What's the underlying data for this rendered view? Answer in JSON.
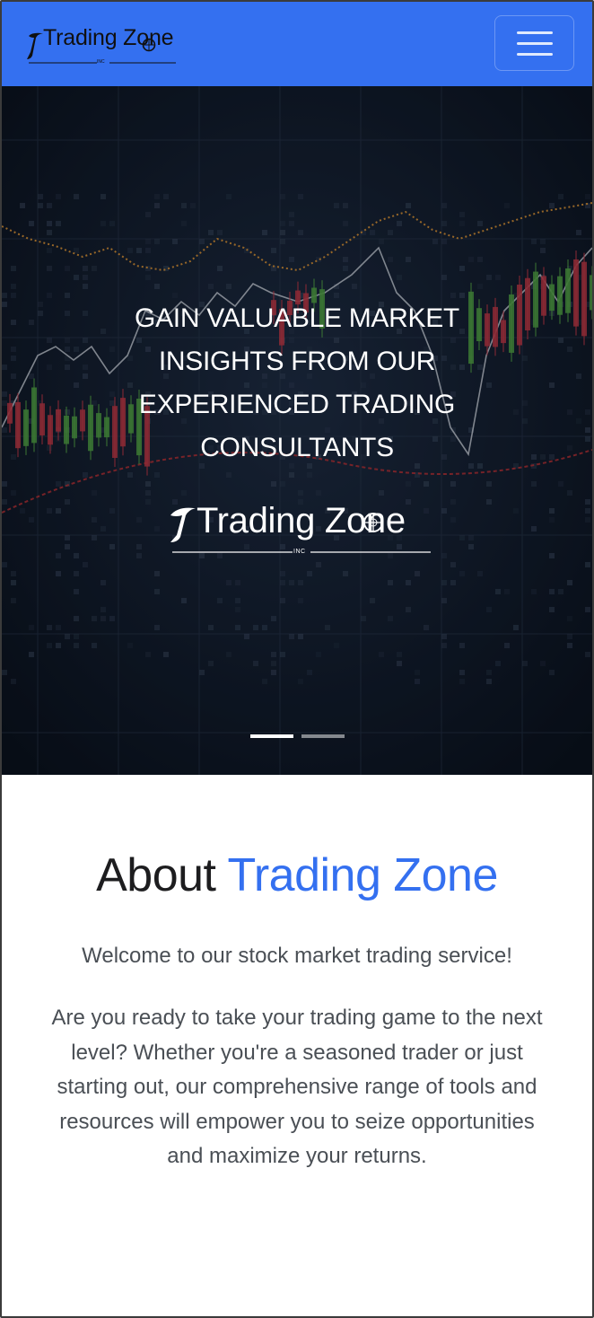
{
  "navbar": {
    "brand_name": "Trading Zone",
    "brand_suffix": "INC",
    "toggle_icon": "hamburger-menu-icon",
    "bg_color": "#3470f0"
  },
  "hero": {
    "headline_lines": [
      "GAIN VALUABLE MARKET",
      "INSIGHTS FROM OUR",
      "EXPERIENCED TRADING",
      "CONSULTANTS"
    ],
    "logo_name": "Trading Zone",
    "logo_suffix": "INC",
    "slides_count": 2,
    "active_slide": 1,
    "background": "stock-candlestick-chart-image"
  },
  "about": {
    "title_prefix": "About",
    "title_accent": "Trading Zone",
    "welcome": "Welcome to our stock market trading service!",
    "body": "Are you ready to take your trading game to the next level? Whether you're a seasoned trader or just starting out, our comprehensive range of tools and resources will empower you to seize opportunities and maximize your returns.",
    "accent_color": "#3470f0"
  }
}
